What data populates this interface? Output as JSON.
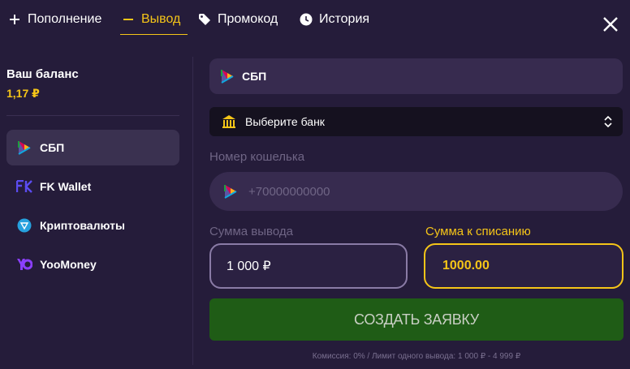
{
  "tabs": [
    {
      "label": "Пополнение",
      "icon": "plus-icon"
    },
    {
      "label": "Вывод",
      "icon": "minus-icon",
      "active": true
    },
    {
      "label": "Промокод",
      "icon": "tag-icon"
    },
    {
      "label": "История",
      "icon": "clock-icon"
    }
  ],
  "sidebar": {
    "balance_label": "Ваш баланс",
    "balance_value": "1,17 ₽",
    "methods": [
      {
        "label": "СБП",
        "icon": "sbp-icon",
        "active": true
      },
      {
        "label": "FK Wallet",
        "icon": "fk-wallet-icon"
      },
      {
        "label": "Криптовалюты",
        "icon": "crypto-icon"
      },
      {
        "label": "YooMoney",
        "icon": "yoomoney-icon"
      }
    ]
  },
  "form": {
    "method_label": "СБП",
    "bank_placeholder": "Выберите банк",
    "wallet_label": "Номер кошелька",
    "wallet_placeholder": "+70000000000",
    "amount_label": "Сумма вывода",
    "amount_value": "1 000 ₽",
    "debit_label": "Сумма к списанию",
    "debit_value": "1000.00",
    "submit_label": "СОЗДАТЬ ЗАЯВКУ",
    "footnote": "Комиссия: 0% / Лимит одного вывода: 1 000 ₽ - 4 999 ₽"
  },
  "colors": {
    "background": "#251c3a",
    "accent": "#f5c518",
    "submit": "#1f5c16"
  }
}
